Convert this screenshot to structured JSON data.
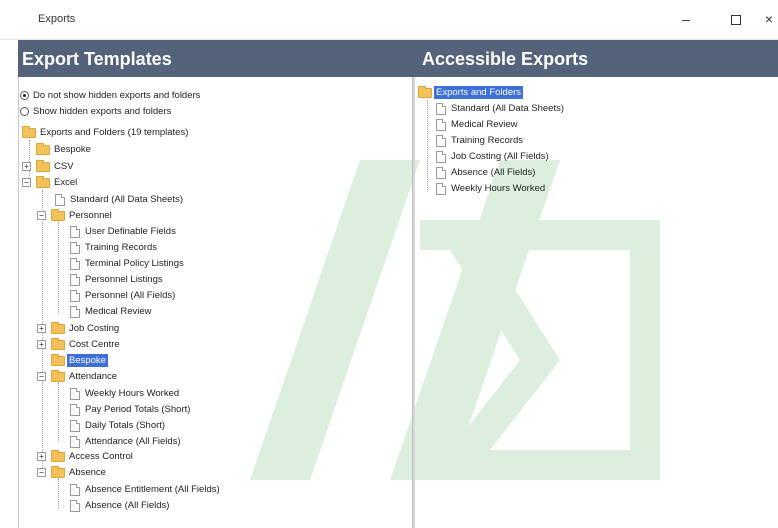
{
  "window": {
    "title": "Exports",
    "minimize": "–",
    "close": "×"
  },
  "headers": {
    "left": "Export Templates",
    "right": "Accessible Exports"
  },
  "options": {
    "hide_hidden": "Do not show hidden exports and folders",
    "show_hidden": "Show hidden exports and folders",
    "selected": "hide_hidden"
  },
  "left_tree": {
    "root": "Exports and Folders (19 templates)",
    "bespoke": "Bespoke",
    "csv": "CSV",
    "excel": "Excel",
    "standard": "Standard (All Data Sheets)",
    "personnel": "Personnel",
    "user_definable": "User Definable Fields",
    "training_records": "Training Records",
    "terminal_policy": "Terminal Policy Listings",
    "personnel_listings": "Personnel Listings",
    "personnel_all": "Personnel (All Fields)",
    "medical_review": "Medical Review",
    "job_costing": "Job Costing",
    "cost_centre": "Cost Centre",
    "bespoke_selected": "Bespoke",
    "attendance": "Attendance",
    "weekly_hours": "Weekly Hours Worked",
    "pay_period": "Pay Period Totals (Short)",
    "daily_totals": "Daily Totals (Short)",
    "attendance_all": "Attendance (All Fields)",
    "access_control": "Access Control",
    "absence": "Absence",
    "absence_entitlement": "Absence Entitlement (All Fields)",
    "absence_all": "Absence (All Fields)"
  },
  "right_tree": {
    "root": "Exports and Folders",
    "standard": "Standard (All Data Sheets)",
    "medical_review": "Medical Review",
    "training_records": "Training Records",
    "job_costing": "Job Costing (All Fields)",
    "absence_all": "Absence (All Fields)",
    "weekly_hours": "Weekly Hours Worked"
  },
  "colors": {
    "header_band": "#54627a",
    "selection": "#3d6fd6",
    "folder": "#f2c35a",
    "watermark": "#2e9b3a"
  }
}
